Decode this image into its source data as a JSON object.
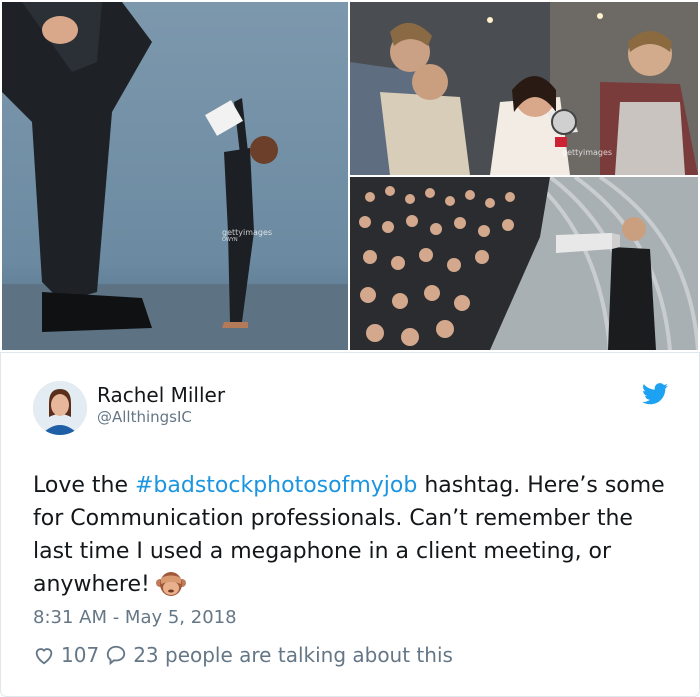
{
  "photos": [
    {
      "alt_icon": "stock-photo-giant-boss",
      "watermark": "gettyimages",
      "watermark_credit": "OWYN"
    },
    {
      "alt_icon": "stock-photo-megaphone-office",
      "watermark": "gettyimages",
      "watermark_credit": ""
    },
    {
      "alt_icon": "stock-photo-crowd-megaphone"
    }
  ],
  "tweet": {
    "author_name": "Rachel Miller",
    "author_handle": "@AllthingsIC",
    "text_before": "Love the ",
    "hashtag": "#badstockphotosofmyjob",
    "text_after": " hashtag. Here’s some for Communication professionals. Can’t remember the last time I used a megaphone in a client meeting, or anywhere!",
    "emoji": "see-no-evil-monkey",
    "timestamp": "8:31 AM - May 5, 2018",
    "likes": "107",
    "replies_text": "23 people are talking about this"
  },
  "colors": {
    "link": "#1b95e0",
    "muted": "#657786",
    "text": "#14171a",
    "twitter_blue": "#1da1f2"
  }
}
